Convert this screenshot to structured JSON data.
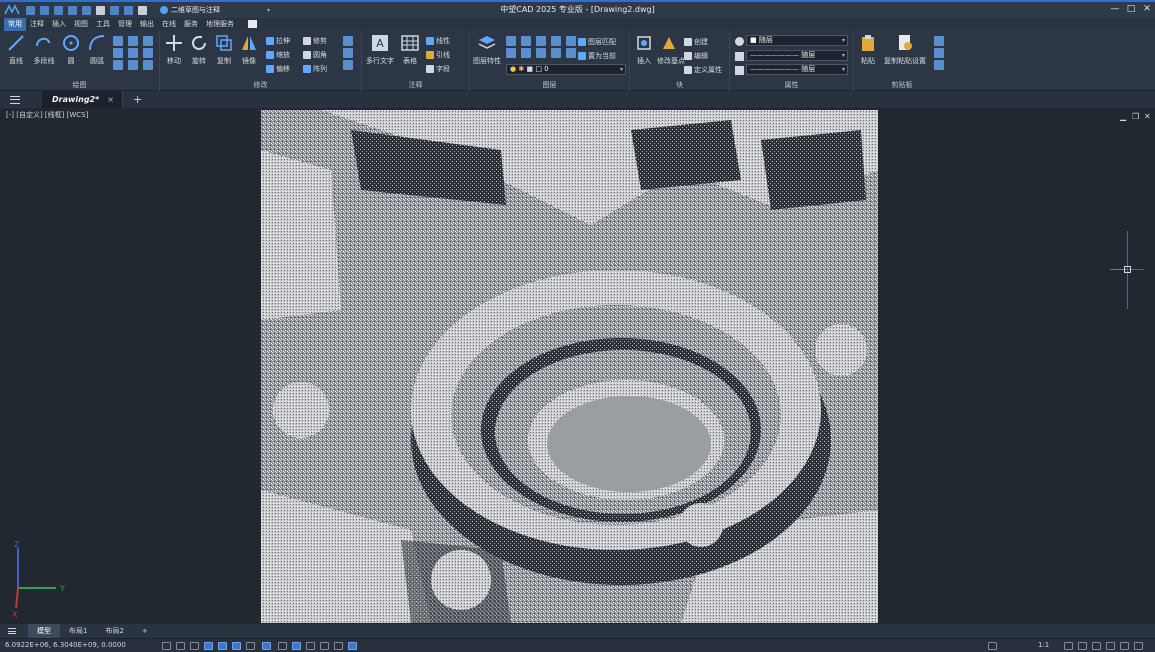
{
  "app": {
    "title": "中望CAD 2025 专业版 - [Drawing2.dwg]",
    "workspace": "二维草图与注释"
  },
  "window_controls": [
    "—",
    "□",
    "✕"
  ],
  "menu": {
    "items": [
      "常用",
      "注释",
      "插入",
      "视图",
      "工具",
      "管理",
      "输出",
      "在线",
      "服务",
      "地理服务"
    ],
    "active": "常用"
  },
  "ribbon": {
    "draw": {
      "label": "绘图",
      "big": [
        "直线",
        "多段线",
        "圆",
        "圆弧"
      ]
    },
    "modify": {
      "label": "修改",
      "big": [
        "移动",
        "旋转",
        "复制",
        "镜像"
      ],
      "small": [
        "拉伸",
        "缩放",
        "偏移",
        "修剪",
        "圆角",
        "阵列"
      ]
    },
    "annotation": {
      "label": "注释",
      "big": [
        "多行文字",
        "表格"
      ],
      "small": [
        "线性",
        "引线",
        "字段"
      ]
    },
    "layers": {
      "label": "图层",
      "big": [
        "图层特性"
      ],
      "small": [
        "图层匹配",
        "置为当前"
      ],
      "current_layer": "0"
    },
    "block": {
      "label": "块",
      "big": [
        "插入",
        "修改基点"
      ],
      "small": [
        "创建",
        "编辑",
        "定义属性"
      ]
    },
    "properties": {
      "label": "属性",
      "color": "随层",
      "linetype": "随层",
      "lineweight": "随层"
    },
    "clipboard": {
      "label": "剪贴板",
      "big": [
        "粘贴",
        "复制粘贴设置"
      ]
    }
  },
  "tabs": {
    "file": "Drawing2*",
    "close": "×",
    "add": "+"
  },
  "viewport": {
    "label": "[-] [自定义] [线框] [WCS]",
    "ucs": {
      "z": "Z",
      "y": "Y",
      "x": "X"
    }
  },
  "layout_tabs": [
    "模型",
    "布局1",
    "布局2",
    "+"
  ],
  "status": {
    "coords": "6.0922E+06, 6.3040E+09, 0.0000",
    "right_text": "1:1"
  },
  "colors": {
    "accent": "#3a6ea8",
    "background": "#212830",
    "ribbon": "#2c3644"
  }
}
